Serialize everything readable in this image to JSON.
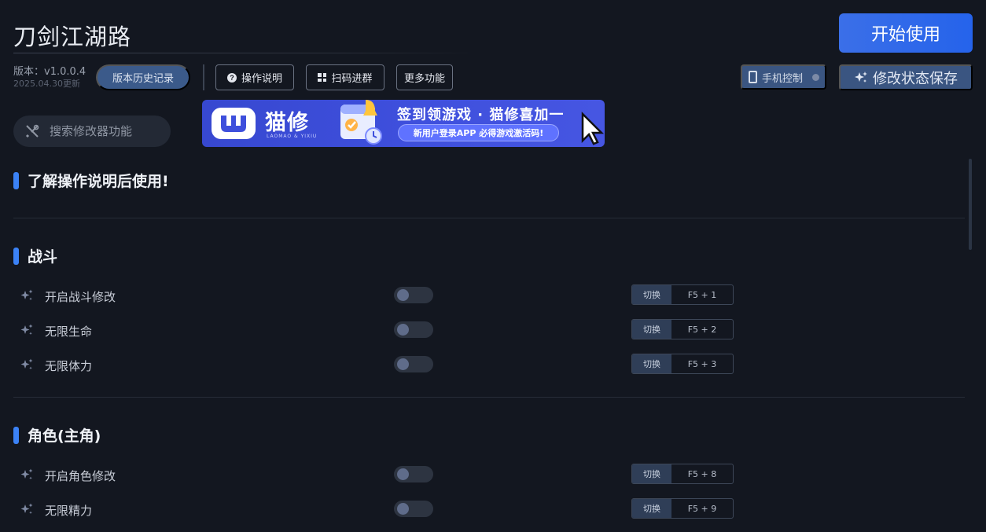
{
  "header": {
    "title": "刀剑江湖路",
    "start_button": "开始使用",
    "version_label": "版本：v1.0.0.4",
    "update_date": "2025.04.30更新",
    "history_button": "版本历史记录",
    "help_button": "操作说明",
    "qr_button": "扫码进群",
    "more_button": "更多功能",
    "phone_button": "手机控制",
    "save_button": "修改状态保存"
  },
  "search": {
    "placeholder": "搜索修改器功能"
  },
  "banner": {
    "brand": "猫修",
    "brand_sub": "LAOMAO & YIXIU",
    "headline": "签到领游戏 · 猫修喜加一",
    "subline": "新用户登录APP  必得游戏激活码!"
  },
  "notice": {
    "title": "了解操作说明后使用!"
  },
  "sections": [
    {
      "title": "战斗",
      "items": [
        {
          "label": "开启战斗修改",
          "toggle": "切换",
          "hotkey": "F5 + 1",
          "enabled": false
        },
        {
          "label": "无限生命",
          "toggle": "切换",
          "hotkey": "F5 + 2",
          "enabled": false
        },
        {
          "label": "无限体力",
          "toggle": "切换",
          "hotkey": "F5 + 3",
          "enabled": false
        }
      ]
    },
    {
      "title": "角色(主角)",
      "items": [
        {
          "label": "开启角色修改",
          "toggle": "切换",
          "hotkey": "F5 + 8",
          "enabled": false
        },
        {
          "label": "无限精力",
          "toggle": "切换",
          "hotkey": "F5 + 9",
          "enabled": false
        }
      ]
    }
  ],
  "colors": {
    "accent": "#3b82f6",
    "background": "#131720",
    "button_blue": "#2563eb"
  }
}
